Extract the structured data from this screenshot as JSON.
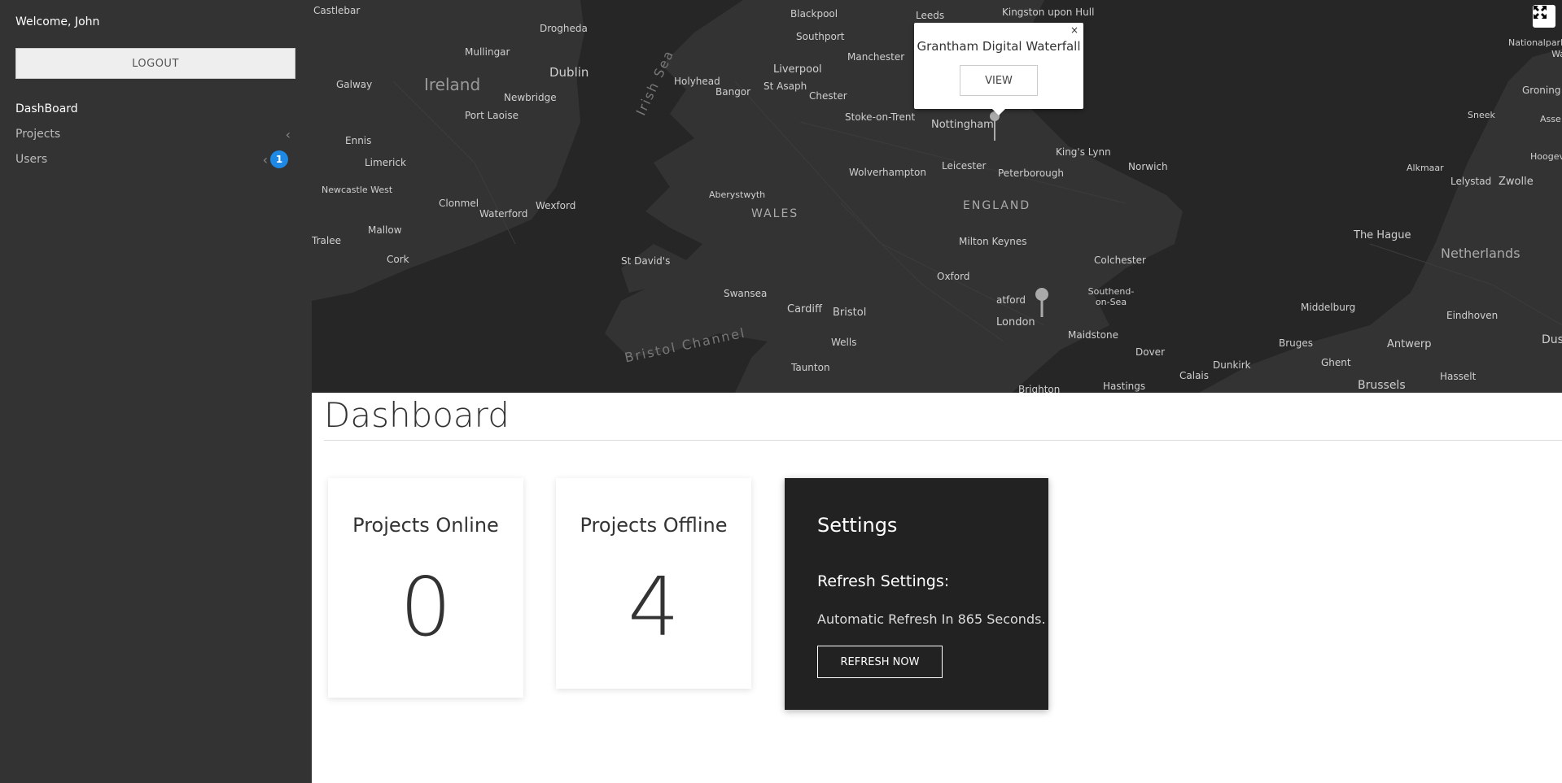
{
  "sidebar": {
    "welcome": "Welcome, John",
    "logout_label": "LOGOUT",
    "items": [
      {
        "label": "DashBoard"
      },
      {
        "label": "Projects"
      },
      {
        "label": "Users",
        "badge": "1"
      }
    ]
  },
  "map": {
    "labels": {
      "castlebar": "Castlebar",
      "drogheda": "Drogheda",
      "blackpool": "Blackpool",
      "leeds": "Leeds",
      "kingston": "Kingston upon Hull",
      "mullingar": "Mullingar",
      "ireland": "Ireland",
      "dublin": "Dublin",
      "southport": "Southport",
      "manchester": "Manchester",
      "galway": "Galway",
      "newbridge": "Newbridge",
      "holyhead": "Holyhead",
      "bangor": "Bangor",
      "liverpool": "Liverpool",
      "stasaph": "St Asaph",
      "chester": "Chester",
      "portlaoise": "Port Laoise",
      "stoke": "Stoke-on-Trent",
      "nottingham": "Nottingham",
      "ennis": "Ennis",
      "limerick": "Limerick",
      "kingslynn": "King's Lynn",
      "norwich": "Norwich",
      "wolverhampton": "Wolverhampton",
      "leicester": "Leicester",
      "peterborough": "Peterborough",
      "newcastlewest": "Newcastle West",
      "aberystwyth": "Aberystwyth",
      "clonmel": "Clonmel",
      "waterford": "Waterford",
      "wexford": "Wexford",
      "wales": "WALES",
      "england": "ENGLAND",
      "mallow": "Mallow",
      "tralee": "Tralee",
      "miltonkeynes": "Milton Keynes",
      "cork": "Cork",
      "stdavids": "St David's",
      "colchester": "Colchester",
      "oxford": "Oxford",
      "swansea": "Swansea",
      "cardiff": "Cardiff",
      "bristol": "Bristol",
      "southend": "Southend-on-Sea",
      "london": "London",
      "maidstone": "Maidstone",
      "wells": "Wells",
      "dover": "Dover",
      "taunton": "Taunton",
      "brighton": "Brighton",
      "hastings": "Hastings",
      "bristolchannel": "Bristol Channel",
      "irishsea": "Irish Sea",
      "nationalpark": "Nationalpark Wa",
      "groningen": "Groning",
      "sneek": "Sneek",
      "assen": "Asse",
      "hoogeveen": "Hoogeve",
      "alkmaar": "Alkmaar",
      "lelystad": "Lelystad",
      "zwolle": "Zwolle",
      "thehague": "The Hague",
      "netherlands": "Netherlands",
      "middelburg": "Middelburg",
      "eindhoven": "Eindhoven",
      "bruges": "Bruges",
      "antwerp": "Antwerp",
      "ghent": "Ghent",
      "dunkirk": "Dunkirk",
      "calais": "Calais",
      "brussels": "Brussels",
      "hasselt": "Hasselt",
      "dus": "Dus",
      "watford": "atford"
    },
    "popup": {
      "title": "Grantham Digital Waterfall",
      "view_label": "VIEW",
      "close": "×"
    },
    "fullscreen_icon": "fullscreen-icon"
  },
  "main": {
    "title": "Dashboard",
    "cards": [
      {
        "title": "Projects Online",
        "value": "0"
      },
      {
        "title": "Projects Offline",
        "value": "4"
      }
    ],
    "settings": {
      "title": "Settings",
      "subtitle": "Refresh Settings:",
      "text": "Automatic Refresh In 865 Seconds.",
      "button_label": "REFRESH NOW"
    }
  },
  "colors": {
    "sidebar": "#333333",
    "map_bg": "#262626",
    "badge": "#1e88e5",
    "settings_bg": "#222222"
  }
}
